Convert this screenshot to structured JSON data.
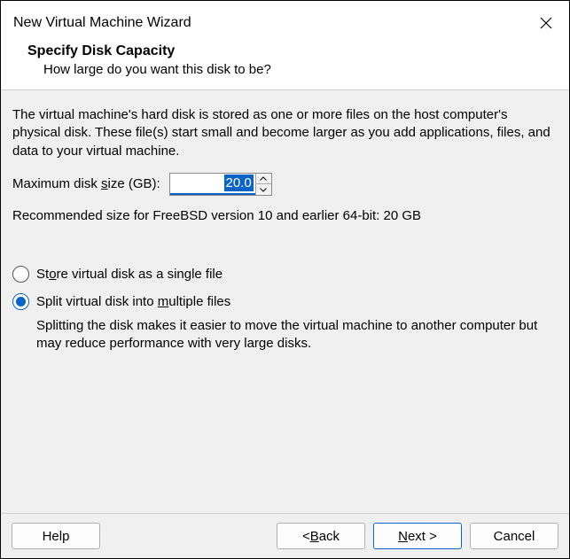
{
  "titlebar": {
    "title": "New Virtual Machine Wizard"
  },
  "header": {
    "title": "Specify Disk Capacity",
    "subtitle": "How large do you want this disk to be?"
  },
  "content": {
    "description": "The virtual machine's hard disk is stored as one or more files on the host computer's physical disk. These file(s) start small and become larger as you add applications, files, and data to your virtual machine.",
    "size_label_pre": "Maximum disk ",
    "size_label_ul": "s",
    "size_label_post": "ize (GB):",
    "size_value": "20.0",
    "recommended": "Recommended size for FreeBSD version 10 and earlier 64-bit: 20 GB"
  },
  "radios": {
    "single": {
      "pre": "St",
      "ul": "o",
      "post": "re virtual disk as a single file",
      "checked": false
    },
    "multi": {
      "pre": "Split virtual disk into ",
      "ul": "m",
      "post": "ultiple files",
      "checked": true
    },
    "multi_description": "Splitting the disk makes it easier to move the virtual machine to another computer but may reduce performance with very large disks."
  },
  "buttons": {
    "help": "Help",
    "back_pre": "< ",
    "back_ul": "B",
    "back_post": "ack",
    "next_ul": "N",
    "next_post": "ext >",
    "cancel": "Cancel"
  }
}
